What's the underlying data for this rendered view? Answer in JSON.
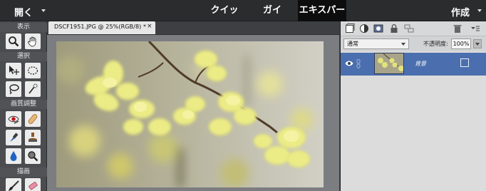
{
  "menubar": {
    "open_label": "開く",
    "modes": [
      "クイック",
      "ガイド",
      "エキスパート"
    ],
    "active_mode": "エキスパート",
    "create_label": "作成"
  },
  "tools": {
    "sections": [
      "表示",
      "選択",
      "画質調整",
      "描画"
    ],
    "items": {
      "zoom": "zoom-tool-icon",
      "hand": "hand-tool-icon",
      "move": "move-tool-icon",
      "marquee": "elliptical-marquee-icon",
      "lasso": "lasso-tool-icon",
      "magic_wand": "quick-selection-icon",
      "red_eye": "red-eye-tool-icon",
      "bandage": "healing-brush-icon",
      "smart_brush": "smart-brush-icon",
      "clone_stamp": "clone-stamp-icon",
      "blur": "blur-drop-icon",
      "sponge": "sponge-tool-icon",
      "brush": "brush-tool-icon",
      "eraser": "eraser-tool-icon"
    }
  },
  "document": {
    "tab_label": "DSCF1951.JPG @ 25%(RGB/8) *",
    "close_glyph": "×"
  },
  "layers_panel": {
    "toolbar_icons": [
      "new-layer-icon",
      "adjustment-layer-icon",
      "layer-mask-icon",
      "lock-icon",
      "link-icon",
      "trash-icon",
      "panel-menu-icon"
    ],
    "blend_mode": "通常",
    "opacity_label": "不透明度:",
    "opacity_value": "100%",
    "layers": [
      {
        "name": "背景",
        "visible": true
      }
    ],
    "colors": {
      "selected_row": "#4b6fae",
      "panel_bg": "#dcdcdc"
    }
  }
}
